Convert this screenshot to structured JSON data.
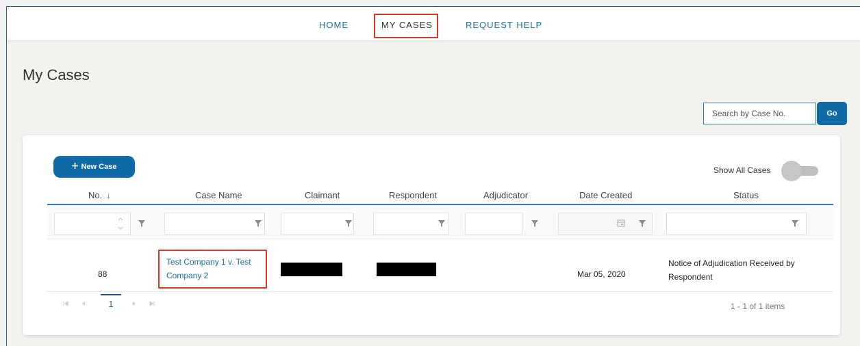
{
  "nav": {
    "home": "HOME",
    "my_cases": "MY CASES",
    "request_help": "REQUEST HELP"
  },
  "page": {
    "title": "My Cases"
  },
  "search": {
    "placeholder": "Search by Case No.",
    "go_label": "Go"
  },
  "toolbar": {
    "new_case_icon": "plus-icon",
    "new_case_label": "New Case",
    "show_all_label": "Show All Cases",
    "show_all_on": false
  },
  "table": {
    "columns": [
      "No.",
      "Case Name",
      "Claimant",
      "Respondent",
      "Adjudicator",
      "Date Created",
      "Status"
    ],
    "sort_indicator": "↓",
    "rows": [
      {
        "no": "88",
        "case_name": "Test Company 1 v. Test Company 2",
        "claimant": "",
        "respondent": "",
        "adjudicator": "",
        "date_created": "Mar 05, 2020",
        "status": "Notice of Adjudication Received by Respondent"
      }
    ]
  },
  "pager": {
    "current_page": "1",
    "summary": "1 - 1 of 1 items"
  },
  "colors": {
    "accent": "#0f6aa5",
    "link": "#1a6fa8",
    "highlight": "#d9381e",
    "background": "#f2f2ee"
  }
}
